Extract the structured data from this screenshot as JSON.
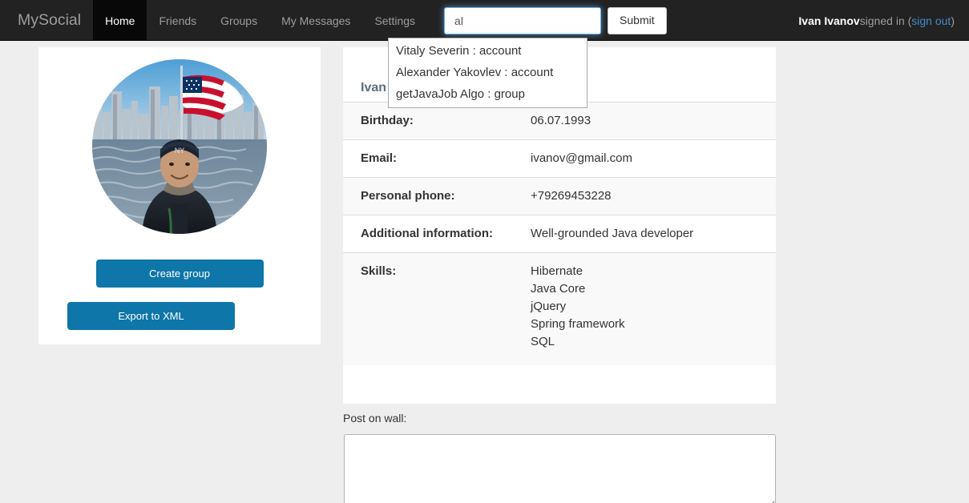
{
  "navbar": {
    "brand": "MySocial",
    "items": [
      {
        "label": "Home",
        "active": true
      },
      {
        "label": "Friends",
        "active": false
      },
      {
        "label": "Groups",
        "active": false
      },
      {
        "label": "My Messages",
        "active": false
      },
      {
        "label": "Settings",
        "active": false
      }
    ],
    "search": {
      "value": "al",
      "placeholder": ""
    },
    "submit_label": "Submit",
    "session": {
      "user_name": "Ivan Ivanov",
      "signed_in_text": " signed in (",
      "sign_out_label": "sign out",
      "closing_paren": ")"
    }
  },
  "autocomplete": {
    "suggestions": [
      "Vitaly Severin : account",
      "Alexander Yakovlev : account",
      "getJavaJob Algo : group"
    ]
  },
  "sidebar": {
    "avatar_alt": "profile-photo",
    "create_group_label": "Create group",
    "export_xml_label": "Export to XML"
  },
  "profile": {
    "name": "Ivan",
    "rows": [
      {
        "label": "Birthday:",
        "value": "06.07.1993"
      },
      {
        "label": "Email:",
        "value": "ivanov@gmail.com"
      },
      {
        "label": "Personal phone:",
        "value": "+79269453228"
      },
      {
        "label": "Additional information:",
        "value": "Well-grounded Java developer"
      }
    ],
    "skills_label": "Skills:",
    "skills": [
      "Hibernate",
      "Java Core",
      "jQuery",
      "Spring framework",
      "SQL"
    ]
  },
  "wall": {
    "label": "Post on wall:",
    "value": "",
    "placeholder": ""
  },
  "colors": {
    "navbar_bg": "#222222",
    "navbar_active_bg": "#080808",
    "navbar_text": "#9d9d9d",
    "accent_button": "#0e76a8",
    "link": "#428bca",
    "page_bg": "#eeeeee",
    "panel_bg": "#ffffff",
    "row_stripe": "#f9f9f9",
    "profile_name": "#5a6f80"
  }
}
